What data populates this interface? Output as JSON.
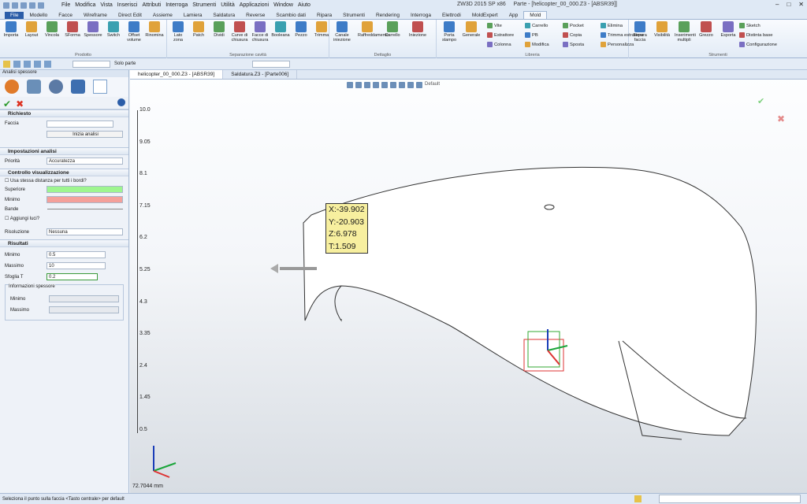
{
  "title_bar": {
    "app": "ZW3D 2015 SP x86",
    "document": "Parte - [helicopter_00_000.Z3 - [ABSR39]]",
    "menus": [
      "File",
      "Modifica",
      "Vista",
      "Inserisci",
      "Attributi",
      "Interroga",
      "Strumenti",
      "Utilità",
      "Applicazioni",
      "Window",
      "Aiuto"
    ]
  },
  "ribbon_tabs": [
    "File",
    "Modello",
    "Facce",
    "Wireframe",
    "Direct Edit",
    "Assieme",
    "Lamiera",
    "Saldatura",
    "Reverse",
    "Scambio dati",
    "Ripara",
    "Strumenti",
    "Rendering",
    "Interroga",
    "Elettrodi",
    "MoldExpert",
    "App",
    "Mold"
  ],
  "ribbon": {
    "prodotto": {
      "label": "Prodotto",
      "buttons": [
        "Importa",
        "Layout",
        "Vincola",
        "SForma",
        "Spessore",
        "Switch",
        "Offset volume",
        "Rinomina"
      ]
    },
    "separazione": {
      "label": "Separazione cavità",
      "buttons": [
        "Lato zona",
        "Patch",
        "Dividi",
        "Curve di chiusura",
        "Facce di chiusura",
        "Booleana",
        "Pezzo",
        "Trimma"
      ]
    },
    "dettaglio": {
      "label": "Dettaglio",
      "buttons": [
        "Canale iniezione",
        "Raffreddamento",
        "Carrello",
        "Iniezione"
      ]
    },
    "libreria": {
      "label": "Libreria",
      "buttons": [
        "Porta stampo",
        "Generale"
      ],
      "small": [
        "Vite",
        "Estrattore",
        "Colonna",
        "Carrello",
        "PB",
        "Modifica",
        "Pocket",
        "Copia",
        "Sposta",
        "Elimina",
        "Trimma estrattore",
        "Personalizza"
      ]
    },
    "strumenti": {
      "label": "Strumenti",
      "buttons": [
        "Separa faccia",
        "Visibilità",
        "Inserimenti multipli",
        "Grezzo",
        "Esporta"
      ],
      "small": [
        "Sketch",
        "Distinta base",
        "Configurazione"
      ]
    }
  },
  "toolbar2": {
    "filter": "Solo parte"
  },
  "panel": {
    "title": "Analisi spessore",
    "required": {
      "label": "Richiesto",
      "face_label": "Faccia",
      "face_value": "",
      "analyze_button": "Inizia analisi"
    },
    "settings": {
      "label": "Impostazioni analisi",
      "priority_label": "Priorità",
      "priority_value": "Accuratezza"
    },
    "display": {
      "label": "Controllo visualizzazione",
      "same_dist": "Usa stessa distanza per tutti i bordi?",
      "upper": "Superiore",
      "lower": "Minimo",
      "bands": "Bande",
      "add_lights": "Aggiungi luci?",
      "resolution_label": "Risoluzione",
      "resolution_value": "Nessuna"
    },
    "results": {
      "label": "Risultati",
      "min_label": "Minimo",
      "min_value": "0.5",
      "max_label": "Massimo",
      "max_value": "10",
      "sheet_label": "Sfoglia T",
      "sheet_value": "0.2",
      "info_label": "Informazioni spessore",
      "info_min": "Minimo",
      "info_max": "Massimo"
    }
  },
  "viewport": {
    "tabs": [
      "helicopter_00_000.Z3 - [ABSR39]",
      "Saldatura.Z3 - [Parte006]"
    ],
    "view_style": "Default",
    "scale_ticks": [
      "10.0",
      "9.05",
      "8.1",
      "7.15",
      "6.2",
      "5.25",
      "4.3",
      "3.35",
      "2.4",
      "1.45",
      "0.5"
    ],
    "scale_readout": "72.7044 mm",
    "tooltip": [
      "X:-39.902",
      "Y:-20.903",
      "Z:6.978",
      "T:1.509"
    ]
  },
  "status": "Seleziona il punto sulla faccia <Tasto centrale> per default"
}
